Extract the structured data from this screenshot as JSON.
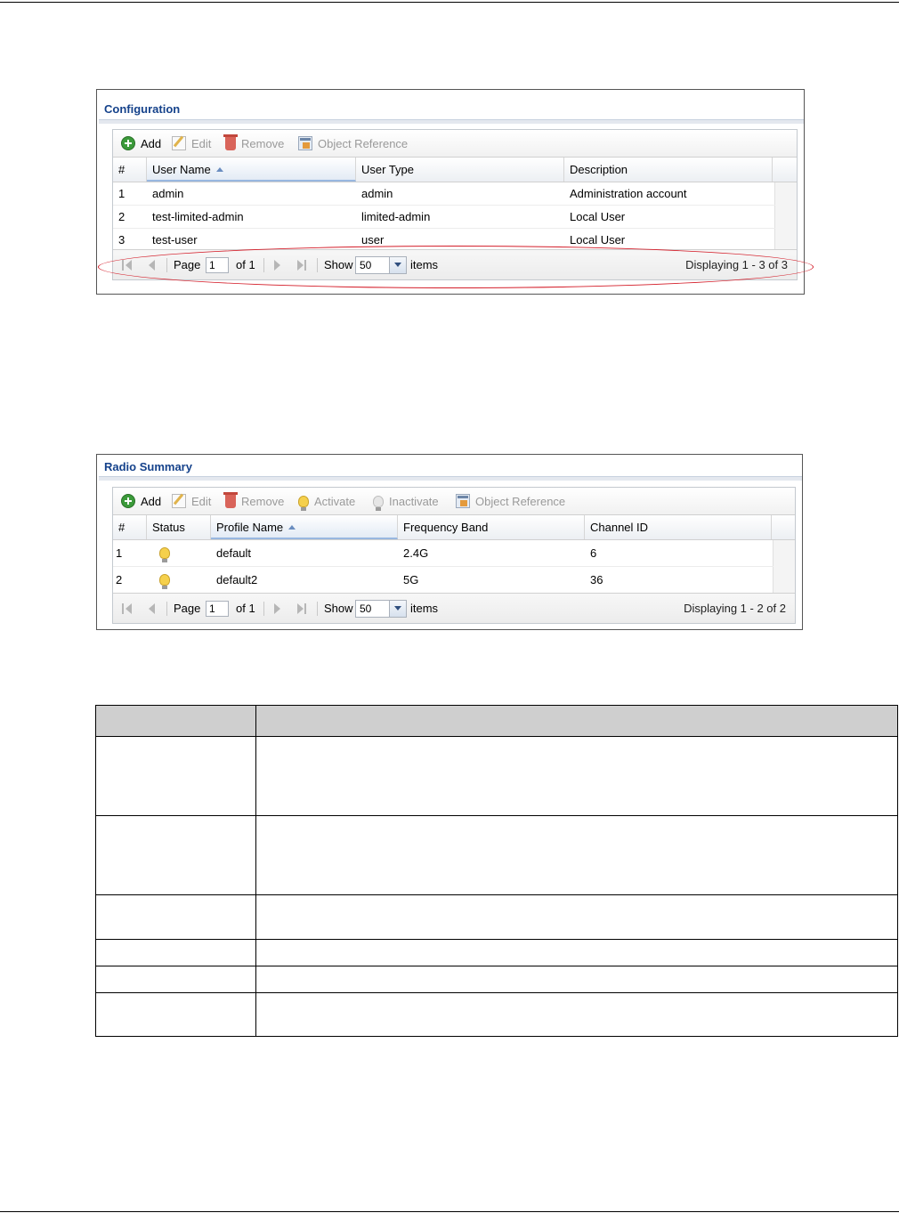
{
  "config_panel": {
    "title": "Configuration",
    "toolbar": {
      "add": "Add",
      "edit": "Edit",
      "remove": "Remove",
      "object_reference": "Object Reference"
    },
    "columns": [
      "#",
      "User Name",
      "User Type",
      "Description"
    ],
    "rows": [
      {
        "num": "1",
        "user_name": "admin",
        "user_type": "admin",
        "description": "Administration account"
      },
      {
        "num": "2",
        "user_name": "test-limited-admin",
        "user_type": "limited-admin",
        "description": "Local User"
      },
      {
        "num": "3",
        "user_name": "test-user",
        "user_type": "user",
        "description": "Local User"
      }
    ],
    "pager": {
      "page_label": "Page",
      "page_value": "1",
      "of_label": "of 1",
      "show_label": "Show",
      "show_value": "50",
      "items_label": "items",
      "displaying": "Displaying 1 - 3 of 3"
    }
  },
  "radio_panel": {
    "title": "Radio Summary",
    "toolbar": {
      "add": "Add",
      "edit": "Edit",
      "remove": "Remove",
      "activate": "Activate",
      "inactivate": "Inactivate",
      "object_reference": "Object Reference"
    },
    "columns": [
      "#",
      "Status",
      "Profile Name",
      "Frequency Band",
      "Channel ID"
    ],
    "rows": [
      {
        "num": "1",
        "status_icon": "bulb-on-icon",
        "profile_name": "default",
        "frequency_band": "2.4G",
        "channel_id": "6"
      },
      {
        "num": "2",
        "status_icon": "bulb-on-icon",
        "profile_name": "default2",
        "frequency_band": "5G",
        "channel_id": "36"
      }
    ],
    "pager": {
      "page_label": "Page",
      "page_value": "1",
      "of_label": "of 1",
      "show_label": "Show",
      "show_value": "50",
      "items_label": "items",
      "displaying": "Displaying 1 - 2 of 2"
    }
  },
  "colors": {
    "title_blue": "#15428b",
    "highlight_ellipse": "#d41e2a",
    "doc_table_header": "#cfcfcf"
  }
}
